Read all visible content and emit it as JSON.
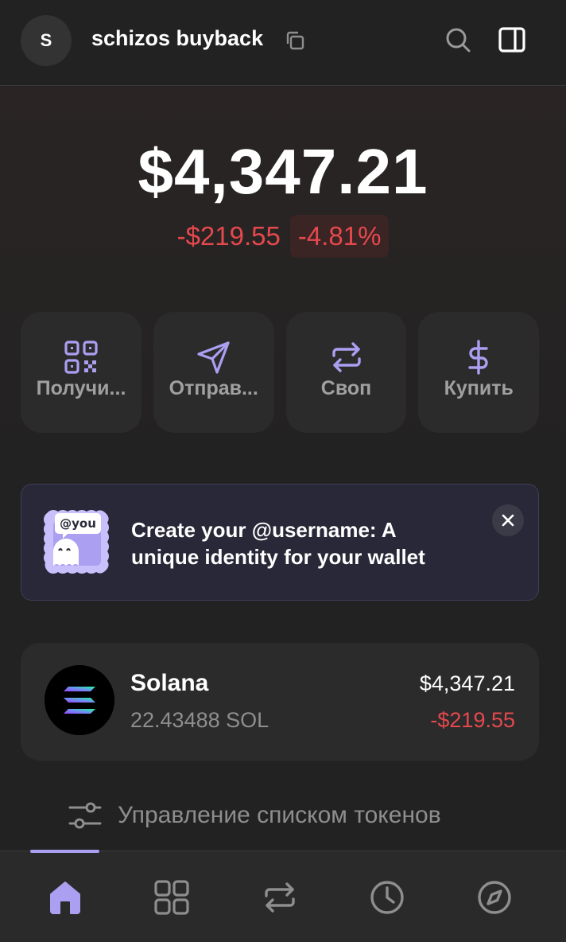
{
  "header": {
    "avatar_letter": "S",
    "account_name": "schizos buyback"
  },
  "balance": {
    "total": "$4,347.21",
    "change_abs": "-$219.55",
    "change_pct": "-4.81%"
  },
  "actions": [
    {
      "label": "Получи...",
      "icon": "qr-code-icon"
    },
    {
      "label": "Отправ...",
      "icon": "send-icon"
    },
    {
      "label": "Своп",
      "icon": "swap-icon"
    },
    {
      "label": "Купить",
      "icon": "dollar-icon"
    }
  ],
  "promo": {
    "badge": "@you",
    "text": "Create your @username: A unique identity for your wallet"
  },
  "tokens": [
    {
      "name": "Solana",
      "amount": "22.43488 SOL",
      "value": "$4,347.21",
      "change": "-$219.55"
    }
  ],
  "manage_label": "Управление списком токенов",
  "colors": {
    "accent": "#ab9ff2",
    "negative": "#e5484d",
    "background": "#222222",
    "card": "#2b2b2b"
  },
  "tabs": [
    {
      "icon": "home-icon",
      "active": true
    },
    {
      "icon": "collectibles-grid-icon",
      "active": false
    },
    {
      "icon": "swap-icon",
      "active": false
    },
    {
      "icon": "history-clock-icon",
      "active": false
    },
    {
      "icon": "explore-compass-icon",
      "active": false
    }
  ]
}
